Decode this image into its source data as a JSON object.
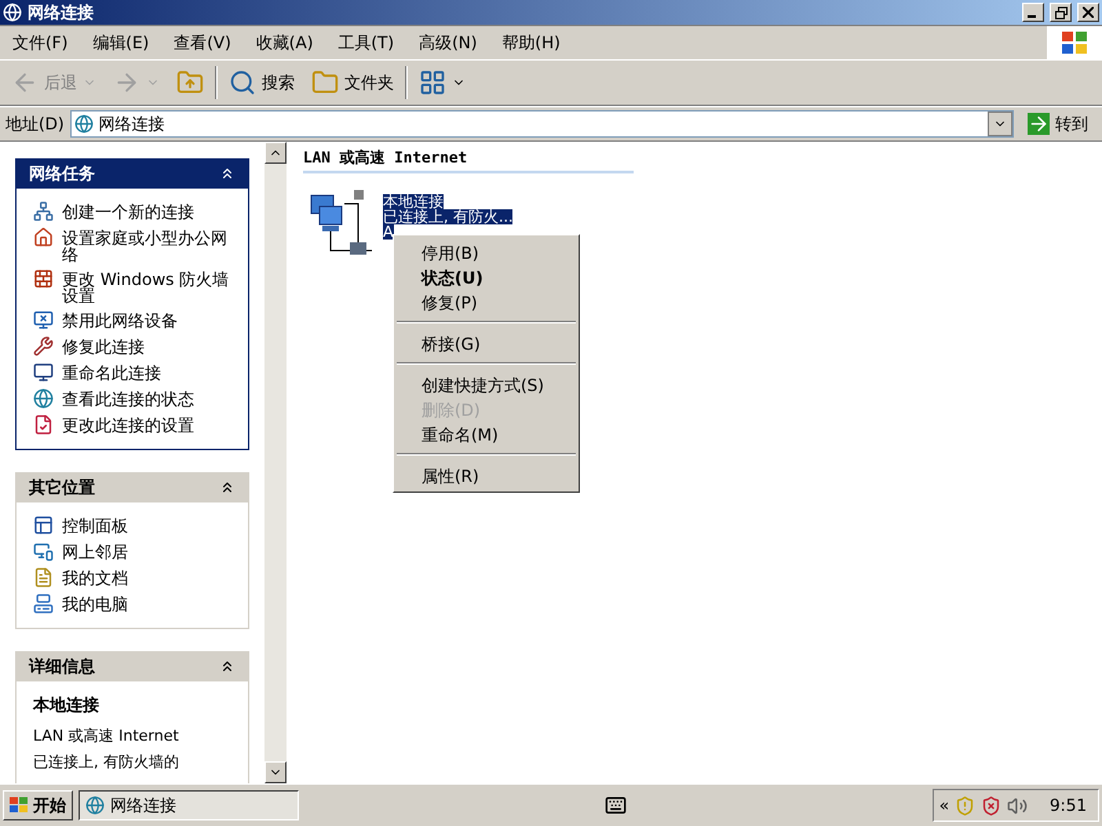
{
  "window": {
    "title": "网络连接"
  },
  "menu": [
    "文件(F)",
    "编辑(E)",
    "查看(V)",
    "收藏(A)",
    "工具(T)",
    "高级(N)",
    "帮助(H)"
  ],
  "toolbar": [
    {
      "kind": "back",
      "label": "后退",
      "disabled": true
    },
    {
      "kind": "forward",
      "disabled": true
    },
    {
      "kind": "up",
      "disabled": false
    },
    {
      "kind": "search",
      "label": "搜索",
      "disabled": false
    },
    {
      "kind": "folders",
      "label": "文件夹",
      "disabled": false
    },
    {
      "kind": "views",
      "disabled": false
    }
  ],
  "address": {
    "label": "地址(D)",
    "value": "网络连接",
    "go": "转到"
  },
  "sidebar": [
    {
      "title": "网络任务",
      "items": [
        "创建一个新的连接",
        "设置家庭或小型办公网络",
        "更改 Windows 防火墙设置",
        "禁用此网络设备",
        "修复此连接",
        "重命名此连接",
        "查看此连接的状态",
        "更改此连接的设置"
      ]
    },
    {
      "title": "其它位置",
      "items": [
        "控制面板",
        "网上邻居",
        "我的文档",
        "我的电脑"
      ]
    },
    {
      "title": "详细信息",
      "details": {
        "name": "本地连接",
        "lines": [
          "LAN 或高速 Internet",
          "已连接上, 有防火墙的"
        ]
      }
    }
  ],
  "content": {
    "group": "LAN 或高速 Internet",
    "connection": {
      "lines": [
        "本地连接",
        "已连接上, 有防火...",
        "A"
      ],
      "selected": true
    }
  },
  "context_menu": [
    {
      "kind": "item",
      "label": "停用(B)",
      "default": false,
      "disabled": false
    },
    {
      "kind": "item",
      "label": "状态(U)",
      "default": true,
      "disabled": false
    },
    {
      "kind": "item",
      "label": "修复(P)",
      "default": false,
      "disabled": false
    },
    {
      "kind": "separator"
    },
    {
      "kind": "item",
      "label": "桥接(G)",
      "default": false,
      "disabled": false
    },
    {
      "kind": "separator"
    },
    {
      "kind": "item",
      "label": "创建快捷方式(S)",
      "default": false,
      "disabled": false
    },
    {
      "kind": "item",
      "label": "删除(D)",
      "default": false,
      "disabled": true
    },
    {
      "kind": "item",
      "label": "重命名(M)",
      "default": false,
      "disabled": false
    },
    {
      "kind": "separator"
    },
    {
      "kind": "item",
      "label": "属性(R)",
      "default": false,
      "disabled": false
    }
  ],
  "taskbar": {
    "start": "开始",
    "tasks": [
      "网络连接"
    ],
    "tray": {
      "expand": "«",
      "clock": "9:51"
    }
  }
}
